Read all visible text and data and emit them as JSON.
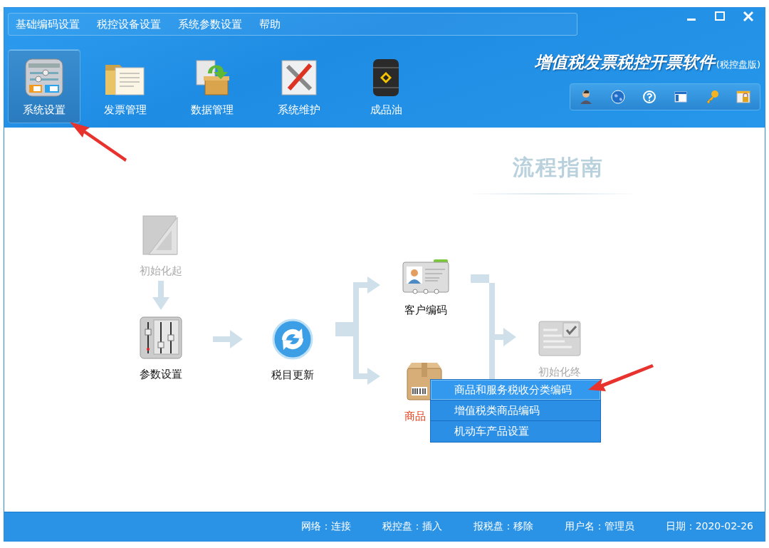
{
  "menubar": [
    "基础编码设置",
    "税控设备设置",
    "系统参数设置",
    "帮助"
  ],
  "toolbar": [
    {
      "label": "系统设置",
      "kind": "settings",
      "selected": true
    },
    {
      "label": "发票管理",
      "kind": "folder",
      "selected": false
    },
    {
      "label": "数据管理",
      "kind": "box",
      "selected": false
    },
    {
      "label": "系统维护",
      "kind": "tools",
      "selected": false
    },
    {
      "label": "成品油",
      "kind": "barrel",
      "selected": false
    }
  ],
  "app_title": {
    "main": "增值税发票税控开票软件",
    "sub": "(税控盘版)"
  },
  "guide_title": "流程指南",
  "flow": {
    "nodes": [
      {
        "label": "初始化起",
        "kind": "start",
        "disabled": true,
        "highlighted": false
      },
      {
        "label": "参数设置",
        "kind": "params",
        "disabled": false,
        "highlighted": false
      },
      {
        "label": "税目更新",
        "kind": "update",
        "disabled": false,
        "highlighted": false
      },
      {
        "label": "客户编码",
        "kind": "customer",
        "disabled": false,
        "highlighted": false
      },
      {
        "label": "商品",
        "kind": "goods",
        "disabled": false,
        "highlighted": true
      },
      {
        "label": "初始化终",
        "kind": "end",
        "disabled": true,
        "highlighted": false
      }
    ]
  },
  "context_menu": [
    {
      "label": "商品和服务税收分类编码",
      "selected": true
    },
    {
      "label": "增值税类商品编码",
      "selected": false
    },
    {
      "label": "机动车产品设置",
      "selected": false
    }
  ],
  "status_bar": [
    {
      "label": "网络：",
      "value": "连接"
    },
    {
      "label": "税控盘：",
      "value": "插入"
    },
    {
      "label": "报税盘：",
      "value": "移除"
    },
    {
      "label": "用户名：",
      "value": "管理员"
    },
    {
      "label": "日期：",
      "value": "2020-02-26"
    }
  ]
}
